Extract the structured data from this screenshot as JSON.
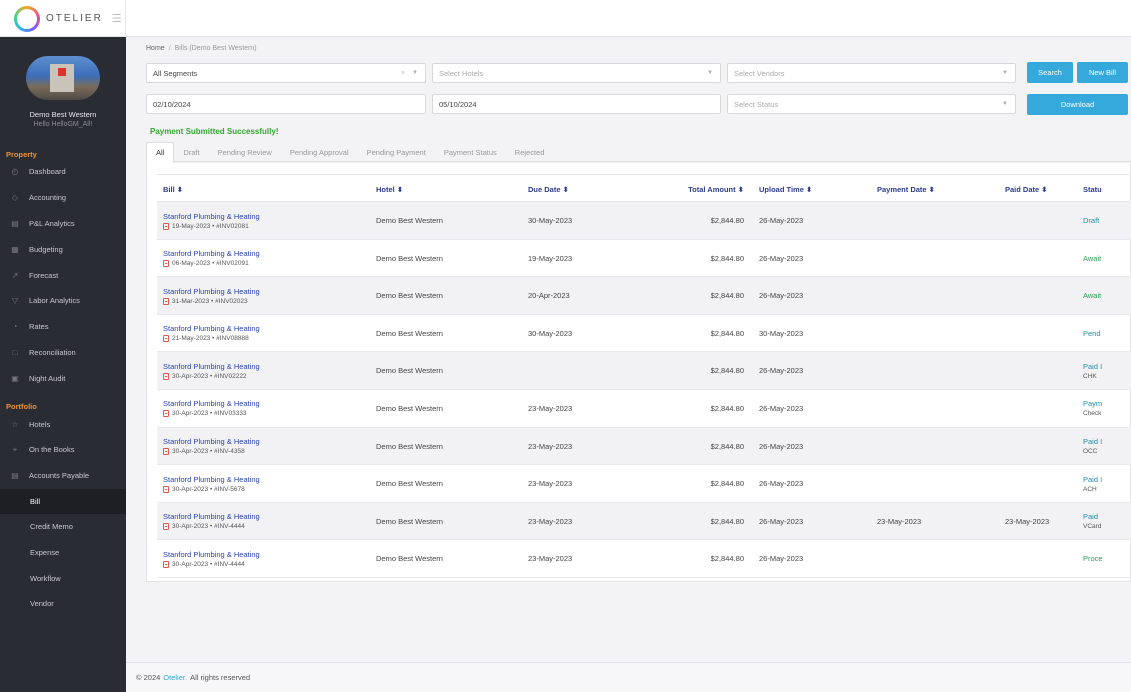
{
  "app": {
    "brand": "OTELIER"
  },
  "profile": {
    "name": "Demo Best Western",
    "greeting": "Hello HelloGM_All!"
  },
  "sidebar": {
    "property_label": "Property",
    "property_items": [
      {
        "label": "Dashboard",
        "icon": "dashboard-icon"
      },
      {
        "label": "Accounting",
        "icon": "accounting-icon"
      },
      {
        "label": "P&L Analytics",
        "icon": "analytics-icon"
      },
      {
        "label": "Budgeting",
        "icon": "budgeting-icon"
      },
      {
        "label": "Forecast",
        "icon": "forecast-icon"
      },
      {
        "label": "Labor Analytics",
        "icon": "labor-icon"
      },
      {
        "label": "Rates",
        "icon": "rates-icon"
      },
      {
        "label": "Reconciliation",
        "icon": "reconciliation-icon"
      },
      {
        "label": "Night Audit",
        "icon": "night-audit-icon"
      }
    ],
    "portfolio_label": "Portfolio",
    "portfolio_items": [
      {
        "label": "Hotels",
        "icon": "star-icon"
      },
      {
        "label": "On the Books",
        "icon": "location-icon"
      },
      {
        "label": "Accounts Payable",
        "icon": "payable-icon"
      }
    ],
    "ap_subitems": [
      "Bill",
      "Credit Memo",
      "Expense",
      "Workflow",
      "Vendor"
    ]
  },
  "breadcrumb": {
    "home": "Home",
    "current": "Bills (Demo Best Western)"
  },
  "filters": {
    "segment": "All Segments",
    "hotels_placeholder": "Select Hotels",
    "vendors_placeholder": "Select Vendors",
    "start_date": "02/10/2024",
    "end_date": "05/10/2024",
    "status_placeholder": "Select Status",
    "search_label": "Search",
    "new_bill_label": "New Bill",
    "download_label": "Download"
  },
  "message": "Payment Submitted Successfully!",
  "tabs": [
    "All",
    "Draft",
    "Pending Review",
    "Pending Approval",
    "Pending Payment",
    "Payment Status",
    "Rejected"
  ],
  "table": {
    "headers": [
      "Bill ⬍",
      "Hotel ⬍",
      "Due Date ⬍",
      "Total Amount ⬍",
      "Upload Time ⬍",
      "Payment Date ⬍",
      "Paid Date ⬍",
      "Statu"
    ],
    "rows": [
      {
        "vendor": "Stanford Plumbing & Heating",
        "meta": "19-May-2023  •  #INV02081",
        "hotel": "Demo Best Western",
        "due": "30-May-2023",
        "amount": "$2,844.80",
        "upload": "26-May-2023",
        "payment": "",
        "paid": "",
        "status": "Draft",
        "status_sub": "",
        "status_color": "#1e8fa8"
      },
      {
        "vendor": "Stanford Plumbing & Heating",
        "meta": "06-May-2023  •  #INV02091",
        "hotel": "Demo Best Western",
        "due": "19-May-2023",
        "amount": "$2,844.80",
        "upload": "26-May-2023",
        "payment": "",
        "paid": "",
        "status": "Await",
        "status_sub": "",
        "status_color": "#2e9e55"
      },
      {
        "vendor": "Stanford Plumbing & Heating",
        "meta": "31-Mar-2023  •  #INV02023",
        "hotel": "Demo Best Western",
        "due": "20-Apr-2023",
        "amount": "$2,844.80",
        "upload": "26-May-2023",
        "payment": "",
        "paid": "",
        "status": "Await",
        "status_sub": "",
        "status_color": "#2e9e55"
      },
      {
        "vendor": "Stanford Plumbing & Heating",
        "meta": "21-May-2023  •  #INV08888",
        "hotel": "Demo Best Western",
        "due": "30-May-2023",
        "amount": "$2,844.80",
        "upload": "30-May-2023",
        "payment": "",
        "paid": "",
        "status": "Pend",
        "status_sub": "",
        "status_color": "#1e8fa8"
      },
      {
        "vendor": "Stanford Plumbing & Heating",
        "meta": "30-Apr-2023  •  #INV02222",
        "hotel": "Demo Best Western",
        "due": "",
        "amount": "$2,844.80",
        "upload": "26-May-2023",
        "payment": "",
        "paid": "",
        "status": "Paid I",
        "status_sub": "CHK",
        "status_color": "#1e8fa8"
      },
      {
        "vendor": "Stanford Plumbing & Heating",
        "meta": "30-Apr-2023  •  #INV03333",
        "hotel": "Demo Best Western",
        "due": "23-May-2023",
        "amount": "$2,844.80",
        "upload": "26-May-2023",
        "payment": "",
        "paid": "",
        "status": "Paym",
        "status_sub": "Check",
        "status_color": "#1e8fa8"
      },
      {
        "vendor": "Stanford Plumbing & Heating",
        "meta": "30-Apr-2023  •  #INV-4358",
        "hotel": "Demo Best Western",
        "due": "23-May-2023",
        "amount": "$2,844.80",
        "upload": "26-May-2023",
        "payment": "",
        "paid": "",
        "status": "Paid I",
        "status_sub": "OCC",
        "status_color": "#1e8fa8"
      },
      {
        "vendor": "Stanford Plumbing & Heating",
        "meta": "30-Apr-2023  •  #INV-5678",
        "hotel": "Demo Best Western",
        "due": "23-May-2023",
        "amount": "$2,844.80",
        "upload": "26-May-2023",
        "payment": "",
        "paid": "",
        "status": "Paid I",
        "status_sub": "ACH",
        "status_color": "#1e8fa8"
      },
      {
        "vendor": "Stanford Plumbing & Heating",
        "meta": "30-Apr-2023  •  #INV-4444",
        "hotel": "Demo Best Western",
        "due": "23-May-2023",
        "amount": "$2,844.80",
        "upload": "26-May-2023",
        "payment": "23-May-2023",
        "paid": "23-May-2023",
        "status": "Paid",
        "status_sub": "VCard",
        "status_color": "#1e8fa8"
      },
      {
        "vendor": "Stanford Plumbing & Heating",
        "meta": "30-Apr-2023  •  #INV-4444",
        "hotel": "Demo Best Western",
        "due": "23-May-2023",
        "amount": "$2,844.80",
        "upload": "26-May-2023",
        "payment": "",
        "paid": "",
        "status": "Proce",
        "status_sub": "",
        "status_color": "#2e9e55"
      }
    ]
  },
  "footer": {
    "prefix": "© 2024",
    "brand": "Otelier.",
    "suffix": "All rights reserved"
  }
}
